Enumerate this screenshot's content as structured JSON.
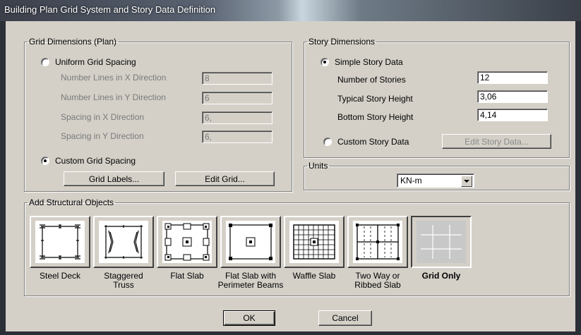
{
  "window": {
    "title": "Building Plan Grid System and Story Data Definition"
  },
  "grid_dimensions": {
    "legend": "Grid Dimensions (Plan)",
    "uniform": {
      "label": "Uniform Grid Spacing",
      "selected": false,
      "fields": [
        {
          "label": "Number Lines in X Direction",
          "value": "8"
        },
        {
          "label": "Number Lines in Y Direction",
          "value": "6"
        },
        {
          "label": "Spacing in X Direction",
          "value": "6,"
        },
        {
          "label": "Spacing in Y Direction",
          "value": "6,"
        }
      ]
    },
    "custom": {
      "label": "Custom Grid Spacing",
      "selected": true
    },
    "grid_labels_button": "Grid Labels...",
    "edit_grid_button": "Edit Grid..."
  },
  "story_dimensions": {
    "legend": "Story Dimensions",
    "simple": {
      "label": "Simple Story Data",
      "selected": true,
      "fields": [
        {
          "label": "Number of Stories",
          "value": "12"
        },
        {
          "label": "Typical Story Height",
          "value": "3,06"
        },
        {
          "label": "Bottom Story Height",
          "value": "4,14"
        }
      ]
    },
    "custom": {
      "label": "Custom Story Data",
      "selected": false
    },
    "edit_story_button": "Edit Story Data..."
  },
  "units": {
    "legend": "Units",
    "selected": "KN-m"
  },
  "structural_objects": {
    "legend": "Add Structural Objects",
    "items": [
      {
        "label": "Steel Deck"
      },
      {
        "label": "Staggered\nTruss"
      },
      {
        "label": "Flat Slab"
      },
      {
        "label": "Flat Slab with\nPerimeter Beams"
      },
      {
        "label": "Waffle Slab"
      },
      {
        "label": "Two Way or\nRibbed Slab"
      },
      {
        "label": "Grid Only",
        "selected": true
      }
    ]
  },
  "buttons": {
    "ok": "OK",
    "cancel": "Cancel"
  },
  "colors": {
    "title_bar": "#3b3f4a",
    "dialog_face": "#d4d0c8",
    "disabled_text": "#7a7a7a"
  }
}
